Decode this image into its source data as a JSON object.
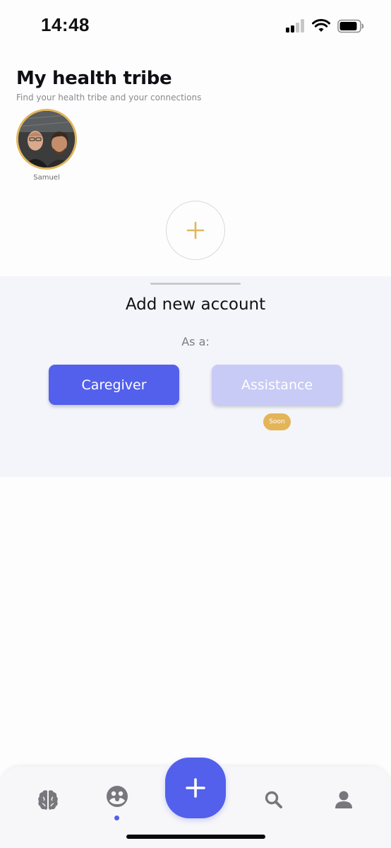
{
  "status_bar": {
    "time": "14:48",
    "icons": [
      "cellular-signal-icon",
      "wifi-icon",
      "battery-icon"
    ]
  },
  "header": {
    "title": "My health tribe",
    "subtitle": "Find your health tribe and your connections"
  },
  "tribe": {
    "members": [
      {
        "name": "Samuel",
        "avatar_icon": "avatar-photo"
      }
    ],
    "add_icon": "plus-icon"
  },
  "sheet": {
    "title": "Add new account",
    "as_label": "As a:",
    "buttons": {
      "caregiver": "Caregiver",
      "assistance": "Assistance"
    },
    "badge": "Soon"
  },
  "bottom_nav": {
    "items": [
      "brain-icon",
      "tribe-icon",
      "plus-icon",
      "search-icon",
      "profile-icon"
    ],
    "active": "tribe-icon"
  },
  "colors": {
    "accent": "#5360ec",
    "accent_light": "#c8cbf6",
    "gold": "#e4b458",
    "nav_icon": "#77777d"
  }
}
